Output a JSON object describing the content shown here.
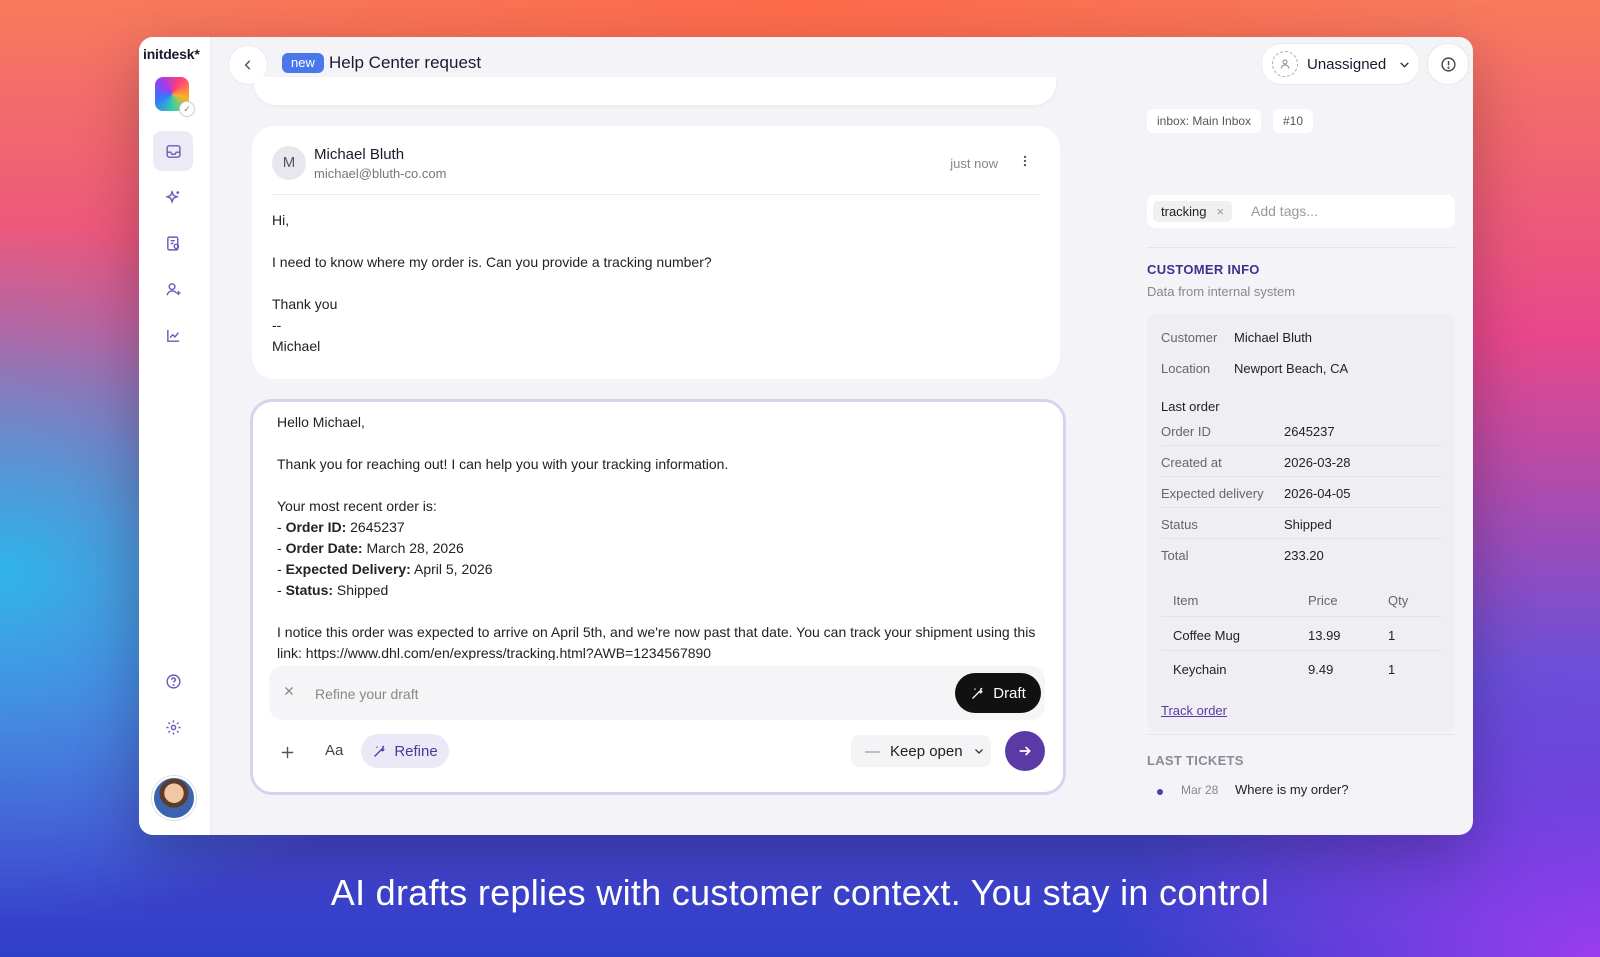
{
  "app": {
    "brand": "initdesk",
    "brand_mark": "*"
  },
  "header": {
    "badge": "new",
    "title": "Help Center request",
    "assignee": "Unassigned"
  },
  "message": {
    "avatar_letter": "M",
    "sender_name": "Michael Bluth",
    "sender_email": "michael@bluth-co.com",
    "time": "just now",
    "body": "Hi,\n\nI need to know where my order is. Can you provide a tracking number?\n\nThank you\n--\nMichael"
  },
  "draft": {
    "greeting": "Hello Michael,",
    "intro": "Thank you for reaching out! I can help you with your tracking information.",
    "recent_label": "Your most recent order is:",
    "lines": [
      {
        "prefix": "- ",
        "label": "Order ID:",
        "value": " 2645237"
      },
      {
        "prefix": "- ",
        "label": "Order Date:",
        "value": " March 28, 2026"
      },
      {
        "prefix": "- ",
        "label": "Expected Delivery:",
        "value": " April 5, 2026"
      },
      {
        "prefix": "- ",
        "label": "Status:",
        "value": " Shipped"
      }
    ],
    "notice": "I notice this order was expected to arrive on April 5th, and we're now past that date. You can track your shipment using this link: https://www.dhl.com/en/express/tracking.html?AWB=1234567890",
    "refine_placeholder": "Refine your draft",
    "draft_button": "Draft",
    "format_label": "Aa",
    "refine_button": "Refine",
    "status_select": "Keep open"
  },
  "panel": {
    "inbox_chip": "inbox: Main Inbox",
    "number_chip": "#10",
    "tag": "tracking",
    "tag_remove": "×",
    "tag_placeholder": "Add tags...",
    "customer_info": {
      "title": "CUSTOMER INFO",
      "subtitle": "Data from internal system",
      "customer_label": "Customer",
      "customer": "Michael Bluth",
      "location_label": "Location",
      "location": "Newport Beach, CA",
      "last_order_label": "Last order",
      "order_fields": [
        {
          "label": "Order ID",
          "value": "2645237"
        },
        {
          "label": "Created at",
          "value": "2026-03-28"
        },
        {
          "label": "Expected delivery",
          "value": "2026-04-05"
        },
        {
          "label": "Status",
          "value": "Shipped"
        },
        {
          "label": "Total",
          "value": "233.20"
        }
      ],
      "items_headers": [
        "Item",
        "Price",
        "Qty"
      ],
      "items": [
        [
          "Coffee Mug",
          "13.99",
          "1"
        ],
        [
          "Keychain",
          "9.49",
          "1"
        ]
      ],
      "track_link": "Track order"
    },
    "last_tickets": {
      "title": "LAST TICKETS",
      "tickets": [
        {
          "date": "Mar 28",
          "subject": "Where is my order?"
        }
      ]
    }
  },
  "caption": "AI drafts replies with customer context. You stay in control",
  "colors": {
    "accent": "#5b3aa6",
    "badge_blue": "#4a78ea",
    "section_title": "#3f2f8f",
    "last_tickets_title": "#8a8a96"
  }
}
